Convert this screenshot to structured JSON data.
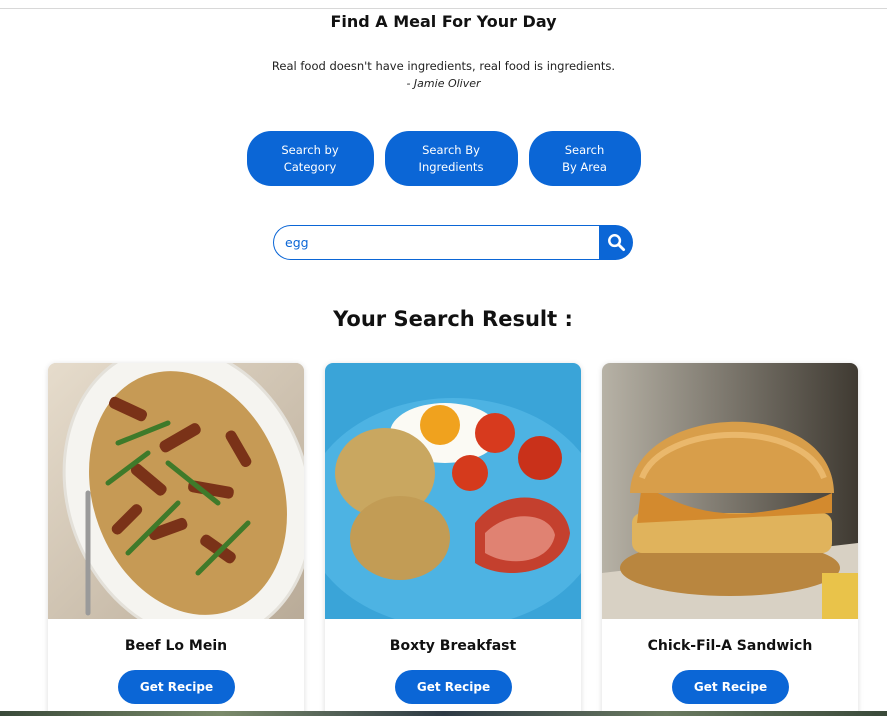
{
  "header": {
    "title": "Find A Meal For Your Day",
    "quote": "Real food doesn't have ingredients, real food is ingredients.",
    "author": "- Jamie Oliver"
  },
  "modes": [
    {
      "line1": "Search by",
      "line2": "Category"
    },
    {
      "line1": "Search By",
      "line2": "Ingredients"
    },
    {
      "line1": "Search",
      "line2": "By Area"
    }
  ],
  "search": {
    "value": "egg",
    "icon": "search-icon"
  },
  "results": {
    "title": "Your Search Result :",
    "cards": [
      {
        "name": "Beef Lo Mein",
        "button": "Get Recipe"
      },
      {
        "name": "Boxty Breakfast",
        "button": "Get Recipe"
      },
      {
        "name": "Chick-Fil-A Sandwich",
        "button": "Get Recipe"
      }
    ]
  },
  "colors": {
    "accent": "#0b66d6"
  }
}
